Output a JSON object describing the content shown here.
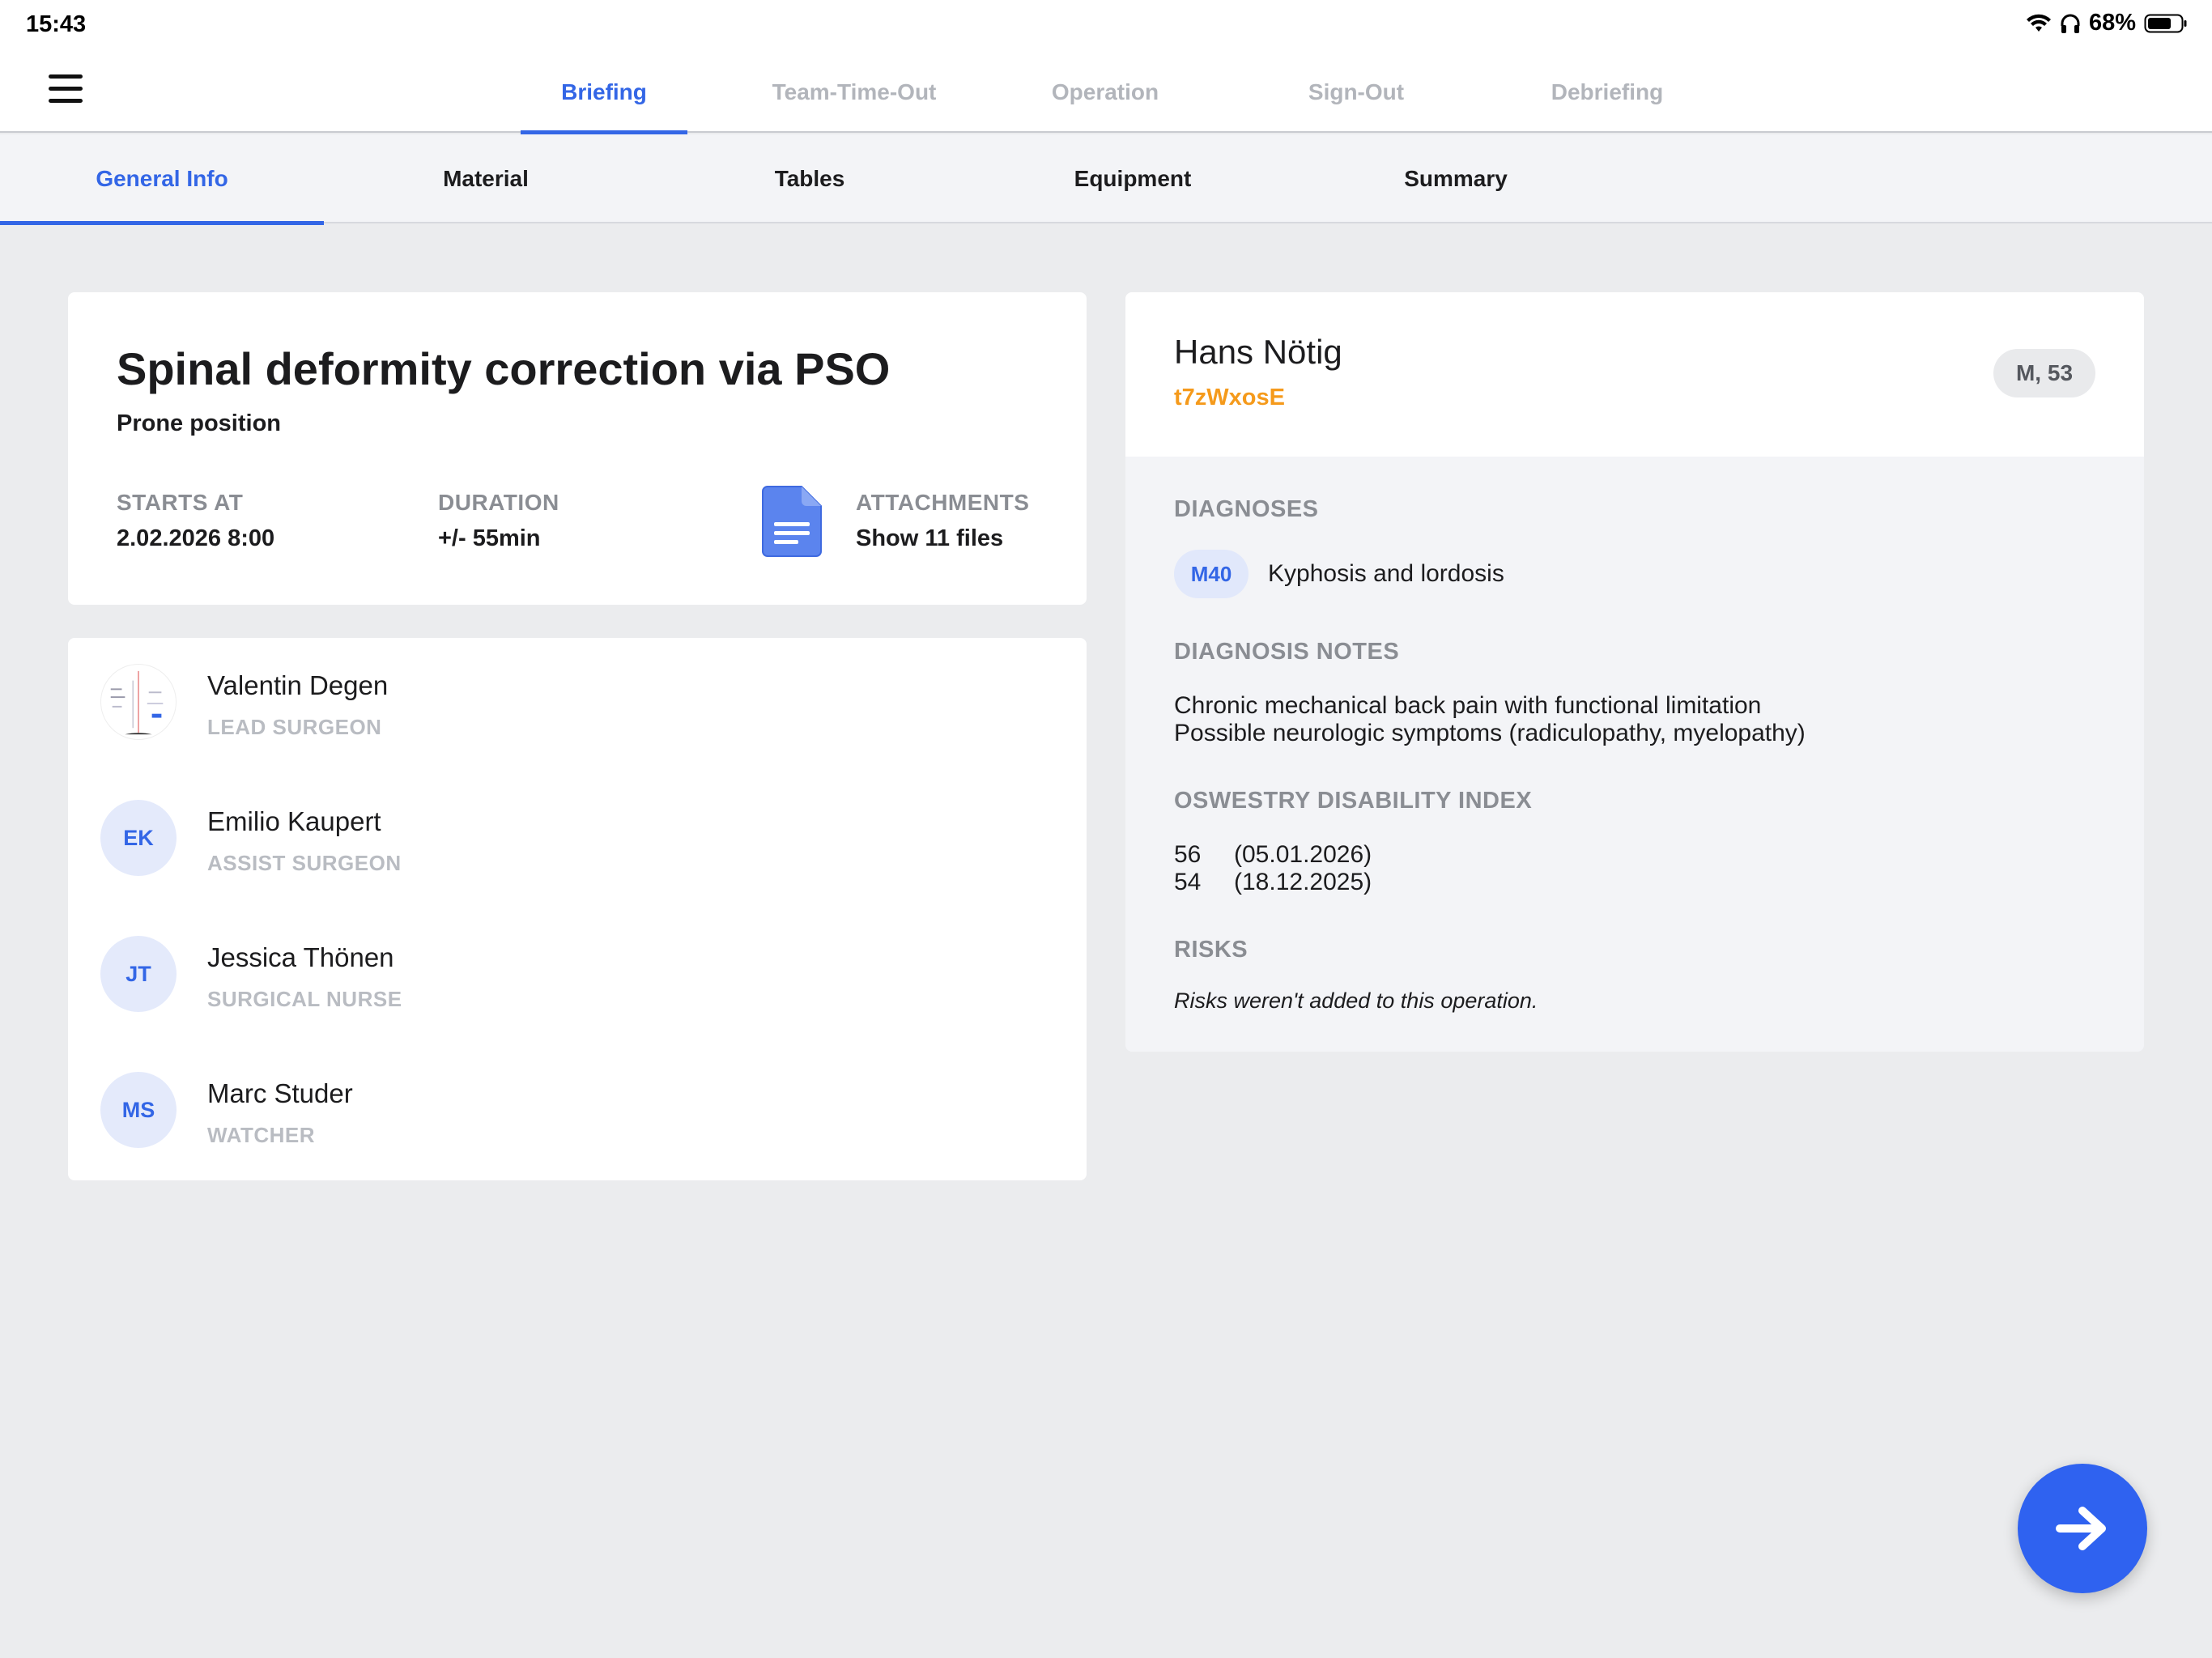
{
  "status_bar": {
    "time": "15:43",
    "battery": "68%",
    "icons": [
      "wifi-icon",
      "headphones-icon",
      "battery-icon"
    ]
  },
  "top_nav": {
    "menu_icon": "hamburger-menu-icon",
    "tabs": [
      {
        "label": "Briefing",
        "active": true
      },
      {
        "label": "Team-Time-Out",
        "active": false
      },
      {
        "label": "Operation",
        "active": false
      },
      {
        "label": "Sign-Out",
        "active": false
      },
      {
        "label": "Debriefing",
        "active": false
      }
    ]
  },
  "sub_nav": {
    "tabs": [
      {
        "label": "General Info",
        "active": true
      },
      {
        "label": "Material",
        "active": false
      },
      {
        "label": "Tables",
        "active": false
      },
      {
        "label": "Equipment",
        "active": false
      },
      {
        "label": "Summary",
        "active": false
      }
    ]
  },
  "operation": {
    "title": "Spinal deformity correction via PSO",
    "position": "Prone position",
    "starts_at_label": "STARTS AT",
    "starts_at_value": "2.02.2026 8:00",
    "duration_label": "DURATION",
    "duration_value": "+/- 55min",
    "attachments_label": "ATTACHMENTS",
    "attachments_value": "Show 11 files",
    "attachments_icon": "document-icon"
  },
  "team": [
    {
      "name": "Valentin Degen",
      "role": "LEAD SURGEON",
      "initials": "",
      "photo": true
    },
    {
      "name": "Emilio Kaupert",
      "role": "ASSIST SURGEON",
      "initials": "EK",
      "photo": false
    },
    {
      "name": "Jessica Thönen",
      "role": "SURGICAL NURSE",
      "initials": "JT",
      "photo": false
    },
    {
      "name": "Marc Studer",
      "role": "WATCHER",
      "initials": "MS",
      "photo": false
    }
  ],
  "patient": {
    "name": "Hans Nötig",
    "id": "t7zWxosE",
    "badge": "M, 53",
    "diagnoses_label": "DIAGNOSES",
    "diagnosis_code": "M40",
    "diagnosis_name": "Kyphosis and lordosis",
    "notes_label": "DIAGNOSIS NOTES",
    "notes": [
      "Chronic mechanical back pain with functional limitation",
      "Possible neurologic symptoms (radiculopathy, myelopathy)"
    ],
    "odi_label": "OSWESTRY DISABILITY INDEX",
    "odi": [
      {
        "value": "56",
        "date": "(05.01.2026)"
      },
      {
        "value": "54",
        "date": "(18.12.2025)"
      }
    ],
    "risks_label": "RISKS",
    "risks_note": "Risks weren't added to this operation."
  },
  "fab": {
    "icon": "arrow-right-icon"
  },
  "colors": {
    "accent": "#3366e6",
    "patient_id": "#f59a1b",
    "background": "#ebecee"
  }
}
